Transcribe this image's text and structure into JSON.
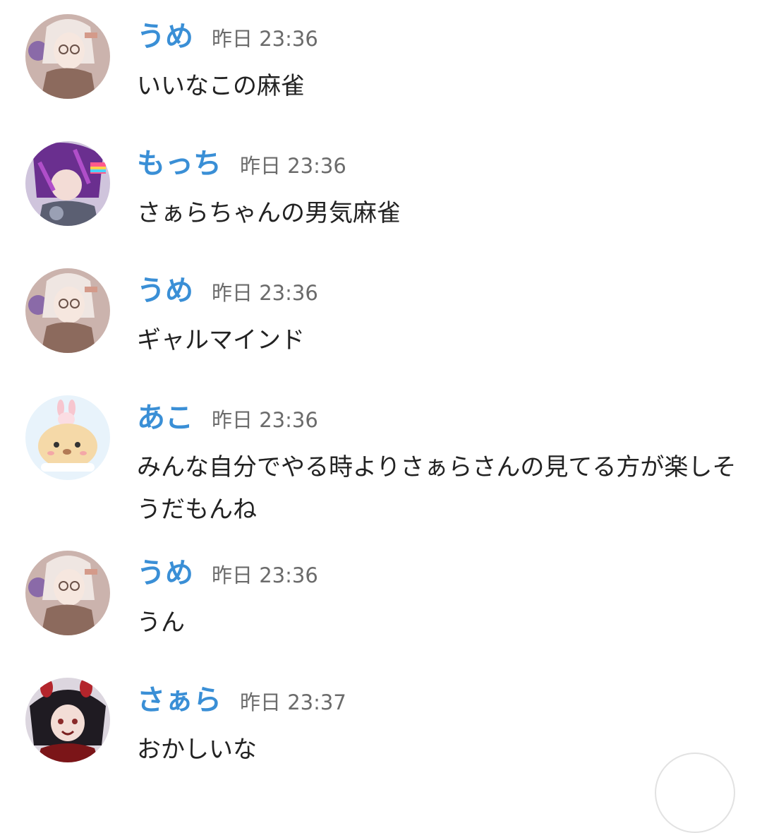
{
  "messages": [
    {
      "name": "うめ",
      "time": "昨日 23:36",
      "text": "いいなこの麻雀",
      "avatar": "ume-avatar"
    },
    {
      "name": "もっち",
      "time": "昨日 23:36",
      "text": "さぁらちゃんの男気麻雀",
      "avatar": "mocchi-avatar"
    },
    {
      "name": "うめ",
      "time": "昨日 23:36",
      "text": "ギャルマインド",
      "avatar": "ume-avatar"
    },
    {
      "name": "あこ",
      "time": "昨日 23:36",
      "text": "みんな自分でやる時よりさぁらさんの見てる方が楽しそうだもんね",
      "avatar": "ako-avatar"
    },
    {
      "name": "うめ",
      "time": "昨日 23:36",
      "text": "うん",
      "avatar": "ume-avatar"
    },
    {
      "name": "さぁら",
      "time": "昨日 23:37",
      "text": "おかしいな",
      "avatar": "saara-avatar"
    }
  ],
  "colors": {
    "name": "#3a8fd6",
    "time": "#6b6b6b",
    "text": "#222222",
    "background": "#ffffff"
  },
  "scroll_button": {
    "icon": "scroll-to-bottom-icon"
  }
}
